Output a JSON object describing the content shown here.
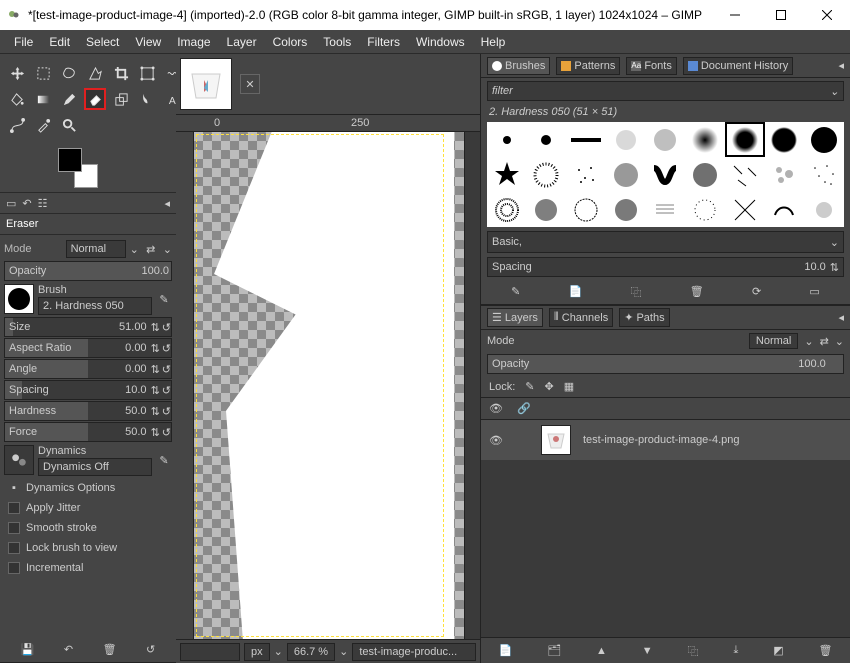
{
  "window": {
    "title": "*[test-image-product-image-4] (imported)-2.0 (RGB color 8-bit gamma integer, GIMP built-in sRGB, 1 layer) 1024x1024 – GIMP"
  },
  "menu": [
    "File",
    "Edit",
    "Select",
    "View",
    "Image",
    "Layer",
    "Colors",
    "Tools",
    "Filters",
    "Windows",
    "Help"
  ],
  "tool": {
    "name": "Eraser"
  },
  "mode": {
    "label": "Mode",
    "value": "Normal"
  },
  "opacity": {
    "label": "Opacity",
    "value": "100.0"
  },
  "brush": {
    "label": "Brush",
    "name": "2. Hardness 050"
  },
  "size": {
    "label": "Size",
    "value": "51.00"
  },
  "aspect": {
    "label": "Aspect Ratio",
    "value": "0.00"
  },
  "angle": {
    "label": "Angle",
    "value": "0.00"
  },
  "spacing_tool": {
    "label": "Spacing",
    "value": "10.0"
  },
  "hardness": {
    "label": "Hardness",
    "value": "50.0"
  },
  "force": {
    "label": "Force",
    "value": "50.0"
  },
  "dynamics": {
    "label": "Dynamics",
    "value": "Dynamics Off"
  },
  "dyn_opts": "Dynamics Options",
  "jitter": "Apply Jitter",
  "smooth": "Smooth stroke",
  "lockview": "Lock brush to view",
  "incremental": "Incremental",
  "ruler": {
    "v0": "0",
    "v250": "250"
  },
  "status": {
    "unit": "px",
    "zoom": "66.7 %",
    "file": "test-image-produc..."
  },
  "rtabs": {
    "brushes": "Brushes",
    "patterns": "Patterns",
    "fonts": "Fonts",
    "history": "Document History"
  },
  "filter": "filter",
  "brush_sel": "2. Hardness 050 (51 × 51)",
  "basic": "Basic,",
  "spacing": {
    "label": "Spacing",
    "value": "10.0"
  },
  "ltabs": {
    "layers": "Layers",
    "channels": "Channels",
    "paths": "Paths"
  },
  "lmode": {
    "label": "Mode",
    "value": "Normal"
  },
  "lopacity": {
    "label": "Opacity",
    "value": "100.0"
  },
  "lock": "Lock:",
  "layer": {
    "name": "test-image-product-image-4.png"
  }
}
